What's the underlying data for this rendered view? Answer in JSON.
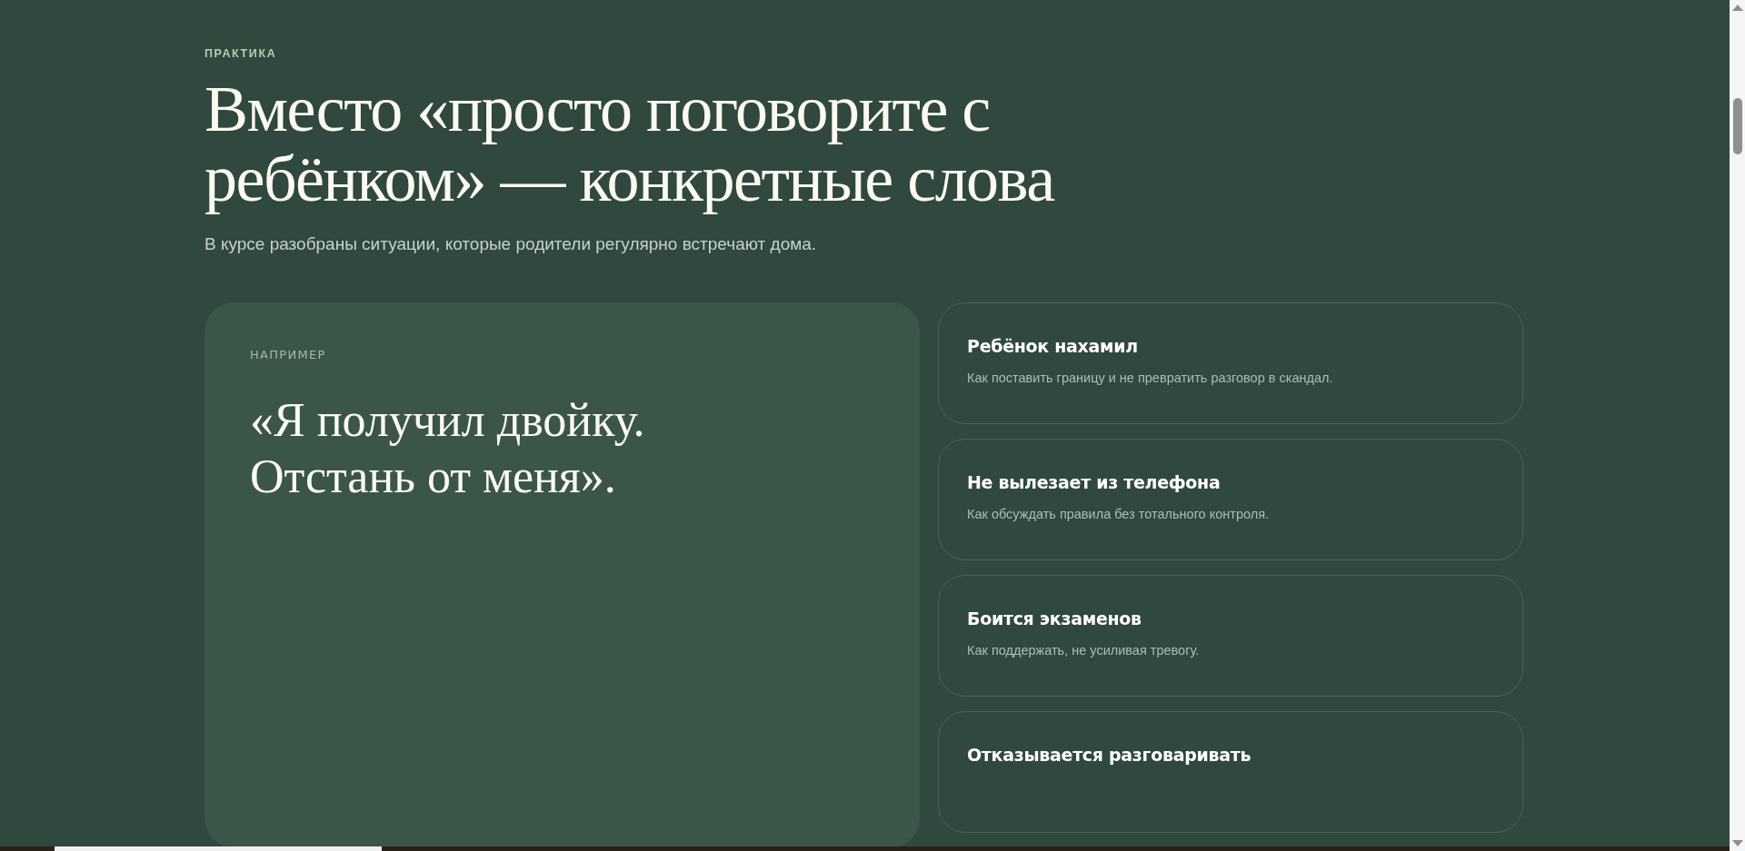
{
  "section": {
    "eyebrow": "ПРАКТИКА",
    "title": "Вместо «просто поговорите с ребёнком» — конкретные слова",
    "subtitle": "В курсе разобраны ситуации, которые родители регулярно встречают дома."
  },
  "example": {
    "label": "НАПРИМЕР",
    "quote": "«Я получил двойку. Отстань от меня»."
  },
  "situations": [
    {
      "title": "Ребёнок нахамил",
      "description": "Как поставить границу и не превратить разговор в скандал."
    },
    {
      "title": "Не вылезает из телефона",
      "description": "Как обсуждать правила без тотального контроля."
    },
    {
      "title": "Боится экзаменов",
      "description": "Как поддержать, не усиливая тревогу."
    },
    {
      "title": "Отказывается разговаривать"
    }
  ]
}
